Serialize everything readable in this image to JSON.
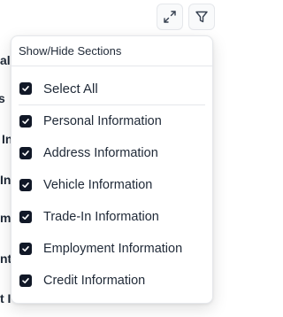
{
  "background": {
    "fragments": [
      "al",
      "s",
      "In",
      "In",
      "m",
      "nt",
      "t I"
    ]
  },
  "toolbar": {
    "expand_icon": "expand-icon",
    "filter_icon": "filter-icon"
  },
  "panel": {
    "title": "Show/Hide Sections",
    "select_all": {
      "label": "Select All",
      "checked": true
    },
    "items": [
      {
        "label": "Personal Information",
        "checked": true
      },
      {
        "label": "Address Information",
        "checked": true
      },
      {
        "label": "Vehicle Information",
        "checked": true
      },
      {
        "label": "Trade-In Information",
        "checked": true
      },
      {
        "label": "Employment Information",
        "checked": true
      },
      {
        "label": "Credit Information",
        "checked": true
      }
    ]
  },
  "colors": {
    "checkbox": "#111827",
    "border": "#e5e7eb",
    "text": "#1f2937"
  }
}
